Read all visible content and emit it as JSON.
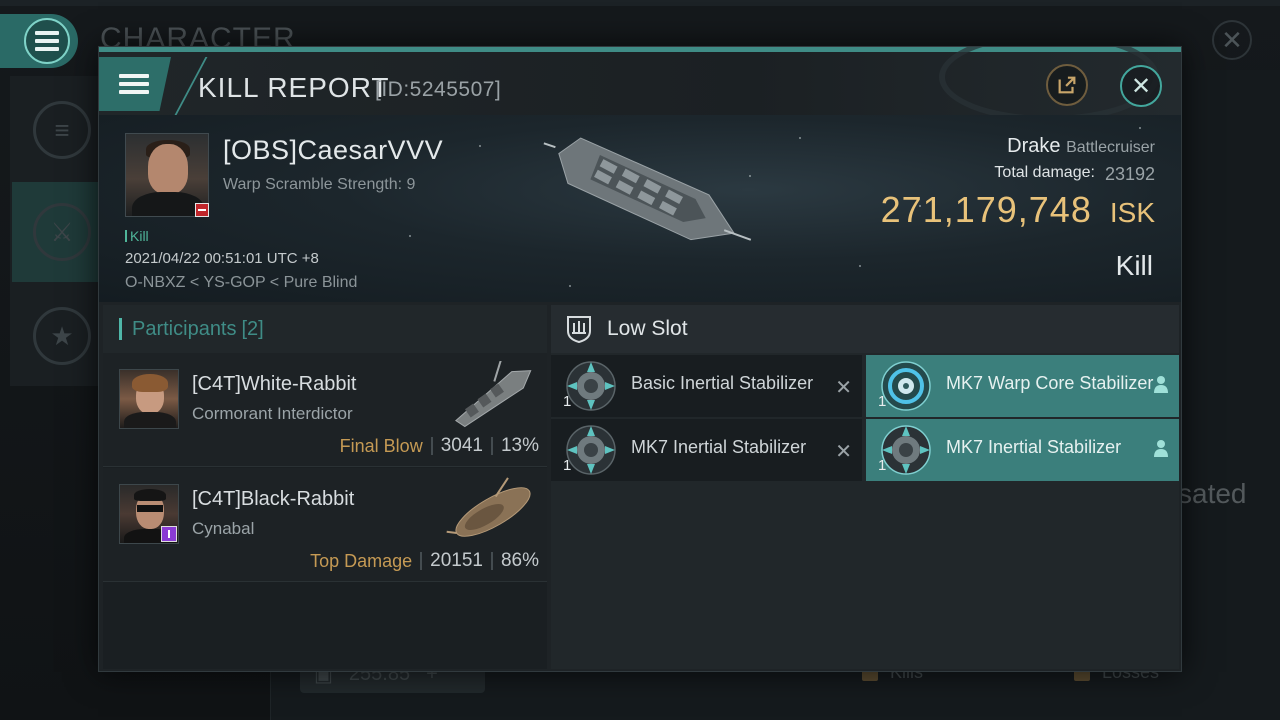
{
  "background": {
    "title": "CHARACTER",
    "right_partial_text": "sated",
    "bottom_value": "255.85",
    "bottom_right_labels": [
      "Kills",
      "Losses"
    ]
  },
  "window": {
    "title": "KILL REPORT",
    "report_id": "[ID:5245507]",
    "icons": {
      "menu": "menu-icon",
      "share": "external-link-icon",
      "close": "close-icon"
    }
  },
  "victim": {
    "name": "[OBS]CaesarVVV",
    "warp_scramble": "Warp Scramble Strength: 9",
    "kill_tag": "Kill",
    "timestamp": "2021/04/22 00:51:01 UTC +8",
    "location": "O-NBXZ < YS-GOP < Pure Blind",
    "ship": "Drake",
    "ship_class": "Battlecruiser",
    "total_damage_label": "Total damage:",
    "total_damage_value": "23192",
    "isk_value": "271,179,748",
    "isk_unit": "ISK",
    "result": "Kill"
  },
  "participants": {
    "label": "Participants",
    "count": "[2]",
    "items": [
      {
        "name": "[C4T]White-Rabbit",
        "ship": "Cormorant Interdictor",
        "role": "Final Blow",
        "damage": "3041",
        "percent": "13%"
      },
      {
        "name": "[C4T]Black-Rabbit",
        "ship": "Cynabal",
        "role": "Top Damage",
        "damage": "20151",
        "percent": "86%"
      }
    ]
  },
  "slots": {
    "header": "Low Slot",
    "items": [
      {
        "name": "Basic Inertial Stabilizer",
        "qty": "1",
        "status": "destroyed",
        "mark": "✕"
      },
      {
        "name": "MK7 Warp Core Stabilizer",
        "qty": "1",
        "status": "dropped"
      },
      {
        "name": "MK7 Inertial Stabilizer",
        "qty": "1",
        "status": "destroyed",
        "mark": "✕"
      },
      {
        "name": "MK7 Inertial Stabilizer",
        "qty": "1",
        "status": "dropped"
      }
    ]
  },
  "colors": {
    "accent": "#3f8c86",
    "isk": "#e8c27a",
    "role": "#c59a54",
    "dropped": "#3b7f7c"
  }
}
